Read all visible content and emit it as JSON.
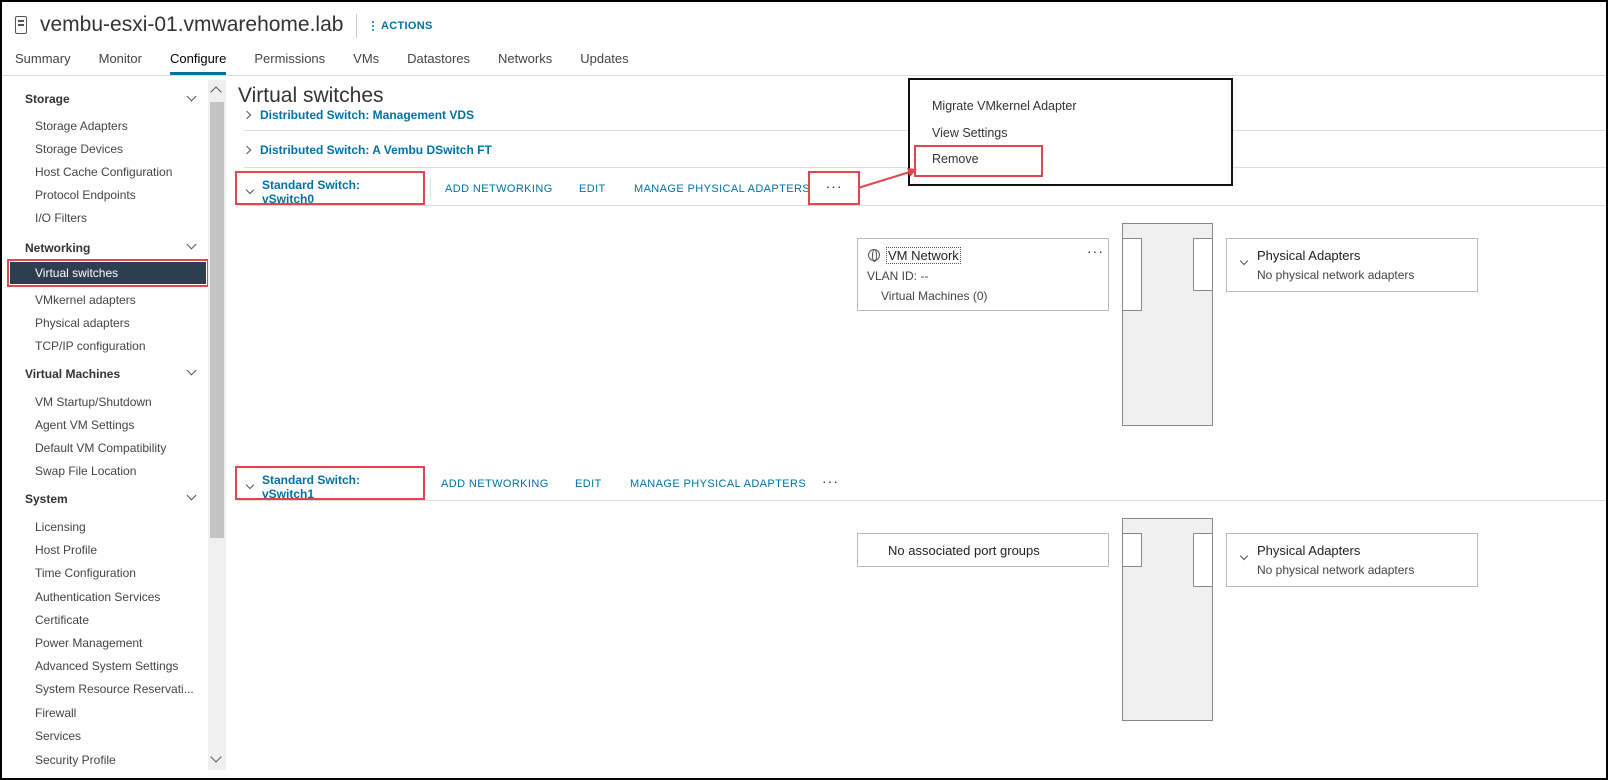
{
  "header": {
    "host_name": "vembu-esxi-01.vmwarehome.lab",
    "actions_label": "ACTIONS",
    "host_icon": "server-icon"
  },
  "tabs": [
    "Summary",
    "Monitor",
    "Configure",
    "Permissions",
    "VMs",
    "Datastores",
    "Networks",
    "Updates"
  ],
  "active_tab": "Configure",
  "sidebar": {
    "sections": [
      {
        "label": "Storage",
        "items": [
          "Storage Adapters",
          "Storage Devices",
          "Host Cache Configuration",
          "Protocol Endpoints",
          "I/O Filters"
        ]
      },
      {
        "label": "Networking",
        "items": [
          "Virtual switches",
          "VMkernel adapters",
          "Physical adapters",
          "TCP/IP configuration"
        ]
      },
      {
        "label": "Virtual Machines",
        "items": [
          "VM Startup/Shutdown",
          "Agent VM Settings",
          "Default VM Compatibility",
          "Swap File Location"
        ]
      },
      {
        "label": "System",
        "items": [
          "Licensing",
          "Host Profile",
          "Time Configuration",
          "Authentication Services",
          "Certificate",
          "Power Management",
          "Advanced System Settings",
          "System Resource Reservati...",
          "Firewall",
          "Services",
          "Security Profile"
        ]
      }
    ],
    "selected": "Virtual switches"
  },
  "main": {
    "title": "Virtual switches",
    "distributed": [
      "Distributed Switch: Management VDS",
      "Distributed Switch: A Vembu DSwitch FT"
    ],
    "switch0": {
      "name": "Standard Switch: vSwitch0",
      "add": "ADD NETWORKING",
      "edit": "EDIT",
      "manage": "MANAGE PHYSICAL ADAPTERS",
      "more": "···",
      "port_group": {
        "name": "VM Network",
        "vlan": "VLAN ID: --",
        "vms": "Virtual Machines (0)",
        "more": "···"
      },
      "physical": {
        "title": "Physical Adapters",
        "text": "No physical network adapters"
      }
    },
    "switch1": {
      "name": "Standard Switch: vSwitch1",
      "add": "ADD NETWORKING",
      "edit": "EDIT",
      "manage": "MANAGE PHYSICAL ADAPTERS",
      "more": "···",
      "port_group": {
        "text": "No associated port groups"
      },
      "physical": {
        "title": "Physical Adapters",
        "text": "No physical network adapters"
      }
    }
  },
  "menu": {
    "items": [
      "Migrate VMkernel Adapter",
      "View Settings",
      "Remove"
    ],
    "highlighted": "Remove"
  },
  "colors": {
    "accent": "#0072a3",
    "highlight": "#e0464b",
    "selected_bg": "#2c3e50"
  }
}
